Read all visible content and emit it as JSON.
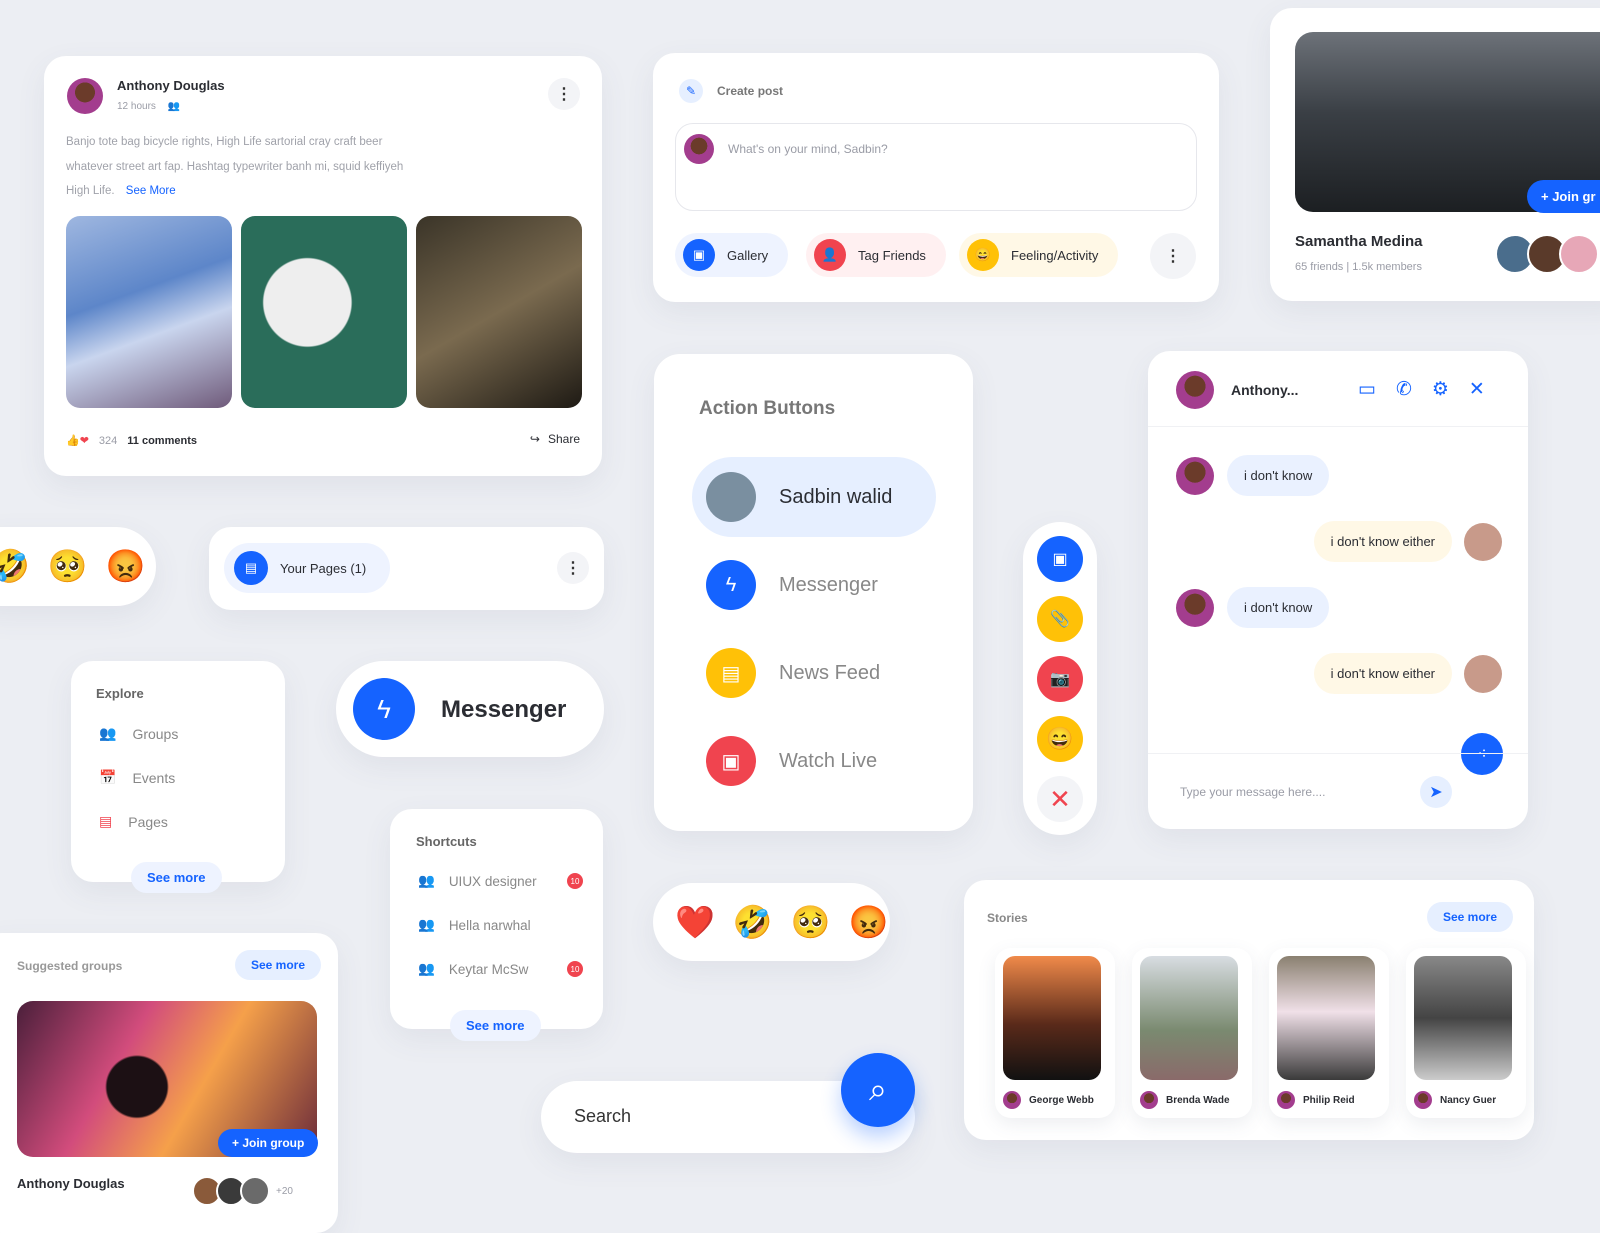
{
  "post": {
    "author": "Anthony Douglas",
    "time": "12 hours",
    "text": "Banjo tote bag bicycle rights, High Life sartorial cray craft beer whatever street art fap. Hashtag typewriter banh mi, squid keffiyeh High Life.",
    "see_more": "See More",
    "likes": "324",
    "comments": "11 comments",
    "share": "Share"
  },
  "create_post": {
    "title": "Create post",
    "placeholder": "What's on your mind, Sadbin?",
    "gallery": "Gallery",
    "tag_friends": "Tag Friends",
    "feeling": "Feeling/Activity"
  },
  "group": {
    "join": "+ Join gr",
    "name": "Samantha Medina",
    "meta": "65 friends | 1.5k members"
  },
  "pages": {
    "label": "Your Pages (1)"
  },
  "explore": {
    "title": "Explore",
    "items": [
      "Groups",
      "Events",
      "Pages"
    ],
    "see_more": "See more"
  },
  "messenger_pill": {
    "label": "Messenger"
  },
  "shortcuts": {
    "title": "Shortcuts",
    "items": [
      {
        "label": "UIUX designer",
        "badge": "10"
      },
      {
        "label": "Hella narwhal",
        "badge": ""
      },
      {
        "label": "Keytar McSw",
        "badge": "10"
      }
    ],
    "see_more": "See more"
  },
  "suggested": {
    "title": "Suggested groups",
    "see_more": "See more",
    "join": "+ Join group",
    "name": "Anthony Douglas",
    "extra": "+20"
  },
  "action_buttons": {
    "title": "Action Buttons",
    "items": [
      "Sadbin walid",
      "Messenger",
      "News Feed",
      "Watch Live"
    ]
  },
  "chat": {
    "name": "Anthony...",
    "messages": [
      {
        "text": "i don't know",
        "side": "left"
      },
      {
        "text": "i don't know either",
        "side": "right"
      },
      {
        "text": "i don't know",
        "side": "left"
      },
      {
        "text": "i don't know either",
        "side": "right"
      }
    ],
    "placeholder": "Type your message here...."
  },
  "stories": {
    "title": "Stories",
    "see_more": "See more",
    "items": [
      "George Webb",
      "Brenda Wade",
      "Philip Reid",
      "Nancy Guer"
    ]
  },
  "search": {
    "placeholder": "Search"
  },
  "emojis": [
    "❤️",
    "🤣",
    "🥺",
    "😡"
  ],
  "colors": {
    "accent": "#1563ff",
    "red": "#f0444f",
    "yellow": "#ffc107"
  }
}
